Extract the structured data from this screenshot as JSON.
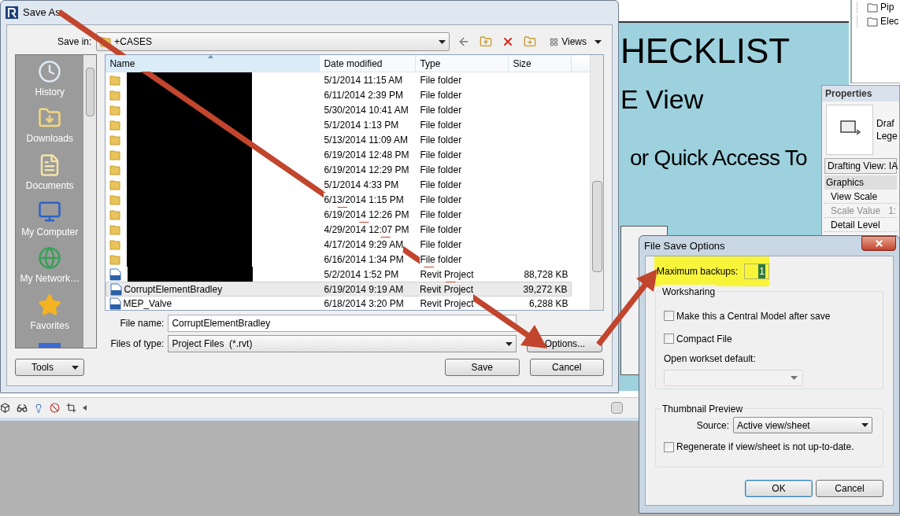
{
  "background": {
    "slide": {
      "lines": [
        "HECKLIST",
        "E View",
        "or Quick Access To"
      ]
    },
    "project_browser": {
      "items": [
        "Pip",
        "Elec"
      ]
    },
    "properties": {
      "title": "Properties",
      "type_lines": [
        "Draf",
        "Lege"
      ],
      "selector": "Drafting View: IA",
      "group": "Graphics",
      "rows": [
        {
          "label": "View Scale",
          "disabled": false
        },
        {
          "label": "Scale Value",
          "value": "1:",
          "disabled": true
        },
        {
          "label": "Detail Level",
          "disabled": false
        }
      ]
    }
  },
  "save_as": {
    "title": "Save As",
    "save_in": {
      "label": "Save in:",
      "value": "+CASES"
    },
    "views_label": "Views",
    "places": [
      {
        "label": "History"
      },
      {
        "label": "Downloads"
      },
      {
        "label": "Documents"
      },
      {
        "label": "My Computer"
      },
      {
        "label": "My Network…"
      },
      {
        "label": "Favorites"
      }
    ],
    "columns": [
      "Name",
      "Date modified",
      "Type",
      "Size"
    ],
    "files": [
      {
        "kind": "folder",
        "redacted": true,
        "date": "5/1/2014 11:15 AM",
        "type": "File folder",
        "selected": false
      },
      {
        "kind": "folder",
        "redacted": true,
        "date": "6/11/2014 2:39 PM",
        "type": "File folder",
        "selected": false
      },
      {
        "kind": "folder",
        "redacted": true,
        "date": "5/30/2014 10:41 AM",
        "type": "File folder",
        "selected": false
      },
      {
        "kind": "folder",
        "redacted": true,
        "date": "5/1/2014 1:13 PM",
        "type": "File folder",
        "selected": false
      },
      {
        "kind": "folder",
        "redacted": true,
        "date": "5/13/2014 11:09 AM",
        "type": "File folder",
        "selected": false
      },
      {
        "kind": "folder",
        "redacted": true,
        "date": "6/19/2014 12:48 PM",
        "type": "File folder",
        "selected": false
      },
      {
        "kind": "folder",
        "redacted": true,
        "date": "6/19/2014 12:29 PM",
        "type": "File folder",
        "selected": false
      },
      {
        "kind": "folder",
        "redacted": true,
        "date": "5/1/2014 4:33 PM",
        "type": "File folder",
        "selected": false
      },
      {
        "kind": "folder",
        "redacted": true,
        "date": "6/13/2014 1:15 PM",
        "type": "File folder",
        "selected": false
      },
      {
        "kind": "folder",
        "redacted": true,
        "date": "6/19/2014 12:26 PM",
        "type": "File folder",
        "selected": false
      },
      {
        "kind": "folder",
        "redacted": true,
        "date": "4/29/2014 12:07 PM",
        "type": "File folder",
        "selected": false
      },
      {
        "kind": "folder",
        "redacted": true,
        "date": "4/17/2014 9:29 AM",
        "type": "File folder",
        "selected": false
      },
      {
        "kind": "folder",
        "redacted": true,
        "date": "6/16/2014 1:34 PM",
        "type": "File folder",
        "selected": false
      },
      {
        "kind": "project",
        "redacted": true,
        "date": "5/2/2014 1:52 PM",
        "type": "Revit Project",
        "size": "88,728 KB",
        "selected": false
      },
      {
        "kind": "project",
        "redacted": false,
        "name": "CorruptElementBradley",
        "date": "6/19/2014 9:19 AM",
        "type": "Revit Project",
        "size": "39,272 KB",
        "selected": true
      },
      {
        "kind": "project",
        "redacted": false,
        "name": "MEP_Valve",
        "date": "6/18/2014 3:20 PM",
        "type": "Revit Project",
        "size": "6,288 KB",
        "selected": false
      }
    ],
    "file_name": {
      "label": "File name:",
      "value": "CorruptElementBradley"
    },
    "file_type": {
      "label": "Files of type:",
      "value": "Project Files  (*.rvt)"
    },
    "buttons": {
      "tools": "Tools",
      "options": "Options...",
      "save": "Save",
      "cancel": "Cancel"
    }
  },
  "file_save_options": {
    "title": "File Save Options",
    "max_backups": {
      "label": "Maximum backups:",
      "value": "1",
      "highlighted": true
    },
    "worksharing": {
      "title": "Worksharing",
      "options": [
        {
          "label": "Make this a Central Model after save",
          "checked": false
        },
        {
          "label": "Compact File",
          "checked": false
        }
      ],
      "workset_label": "Open workset default:",
      "workset_disabled": true
    },
    "thumbnail": {
      "title": "Thumbnail Preview",
      "source_label": "Source:",
      "source_value": "Active view/sheet",
      "regenerate": {
        "label": "Regenerate if view/sheet is not up-to-date.",
        "checked": false
      }
    },
    "buttons": {
      "ok": "OK",
      "cancel": "Cancel"
    }
  }
}
